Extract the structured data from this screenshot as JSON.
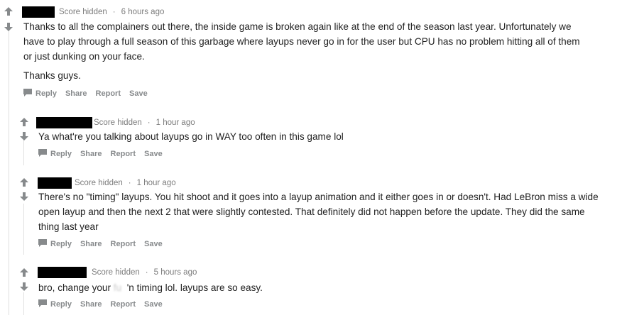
{
  "colors": {
    "redaction": "#000000",
    "meta_text": "#7c7c7c",
    "action_text": "#878a8c",
    "body_text": "#222222",
    "thread_line": "#e0e0e0",
    "vote_arrow": "#878a8c"
  },
  "icons": {
    "upvote": "arrow-up-icon",
    "downvote": "arrow-down-icon",
    "reply": "speech-bubble-icon"
  },
  "comments": [
    {
      "score": "Score hidden",
      "sep": "·",
      "time": "6 hours ago",
      "paragraphs": [
        "Thanks to all the complainers out there, the inside game is broken again like at the end of the season last year. Unfortunately we have to play through a full season of this garbage where layups never go in for the user but CPU has no problem hitting all of them or just dunking on your face.",
        "Thanks guys."
      ],
      "actions": {
        "reply": "Reply",
        "share": "Share",
        "report": "Report",
        "save": "Save"
      }
    },
    {
      "score": "Score hidden",
      "sep": "·",
      "time": "1 hour ago",
      "paragraphs": [
        "Ya what're you talking about layups go in WAY too often in this game lol"
      ],
      "actions": {
        "reply": "Reply",
        "share": "Share",
        "report": "Report",
        "save": "Save"
      }
    },
    {
      "score": "Score hidden",
      "sep": "·",
      "time": "1 hour ago",
      "paragraphs": [
        "There's no \"timing\" layups. You hit shoot and it goes into a layup animation and it either goes in or doesn't. Had LeBron miss a wide open layup and then the next 2 that were slightly contested. That definitely did not happen before the update. They did the same thing last year"
      ],
      "actions": {
        "reply": "Reply",
        "share": "Share",
        "report": "Report",
        "save": "Save"
      }
    },
    {
      "score": "Score hidden",
      "sep": "·",
      "time": "5 hours ago",
      "text_before": "bro, change your ",
      "text_blurred": "fu",
      "text_blurred_gap": "  ",
      "text_after": "'n timing lol. layups are so easy.",
      "actions": {
        "reply": "Reply",
        "share": "Share",
        "report": "Report",
        "save": "Save"
      }
    }
  ]
}
